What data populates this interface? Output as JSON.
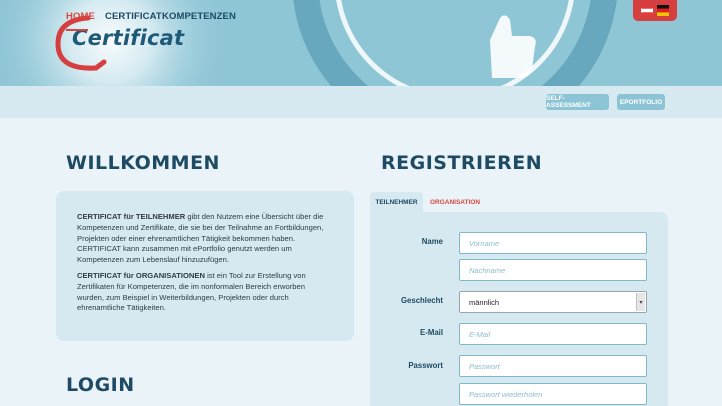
{
  "header": {
    "logo_text": "Certificat",
    "language_flags": [
      "austria-flag-icon",
      "germany-flag-icon"
    ]
  },
  "nav": {
    "items": [
      {
        "label": "HOME",
        "active": true
      },
      {
        "label": "CERTIFICAT",
        "active": false
      },
      {
        "label": "KOMPETENZEN",
        "active": false
      }
    ],
    "buttons": [
      {
        "label": "SELF-ASSESSMENT"
      },
      {
        "label": "EPORTFOLIO"
      }
    ]
  },
  "welcome": {
    "title": "WILLKOMMEN",
    "p1_strong": "CERTIFICAT für TEILNEHMER",
    "p1_text": " gibt den Nutzern eine Übersicht über die Kompetenzen und Zertifikate, die sie bei der Teilnahme an Fortbildungen, Projekten oder einer ehrenamtlichen Tätigkeit bekommen haben. CERTIFICAT kann zusammen mit ePortfolio genutzt werden um Kompetenzen zum Lebenslauf hinzuzufügen.",
    "p2_strong": "CERTIFICAT für ORGANISATIONEN",
    "p2_text": " ist ein Tool zur Erstellung von Zertifikaten für Kompetenzen, die im nonformalen Bereich erworben wurden, zum Beispiel in Weiterbildungen, Projekten oder durch ehrenamtliche Tätigkeiten."
  },
  "login": {
    "title": "LOGIN"
  },
  "register": {
    "title": "REGISTRIEREN",
    "tabs": [
      {
        "label": "TEILNEHMER",
        "active": true
      },
      {
        "label": "ORGANISATION",
        "active": false
      }
    ],
    "labels": {
      "name": "Name",
      "gender": "Geschlecht",
      "email": "E-Mail",
      "password": "Passwort"
    },
    "placeholders": {
      "firstname": "Vorname",
      "lastname": "Nachname",
      "email": "E-Mail",
      "password": "Passwort",
      "password_repeat": "Passwort wiederholen"
    },
    "gender_selected": "männlich"
  },
  "colors": {
    "accent_red": "#d9463e",
    "navy": "#1e4a63",
    "banner": "#8fc6d6",
    "panel": "#d6e9f0"
  }
}
